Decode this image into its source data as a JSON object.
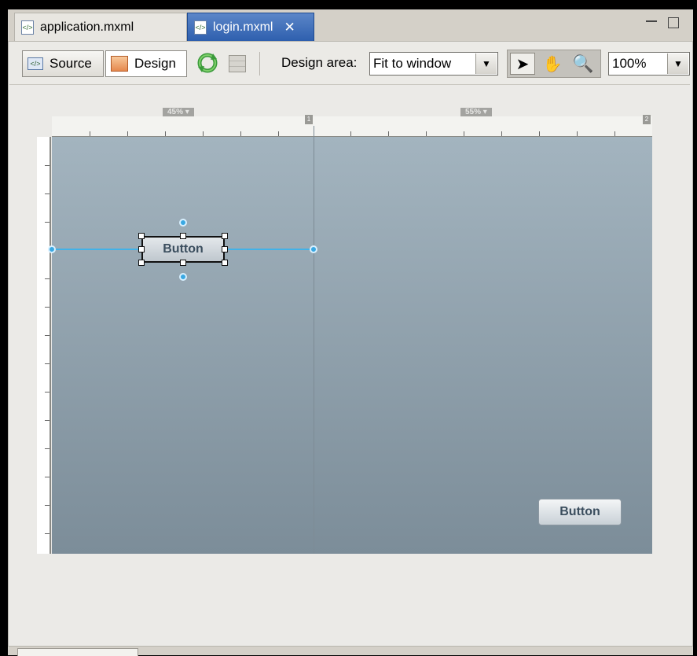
{
  "tabs": [
    {
      "label": "application.mxml",
      "active": false
    },
    {
      "label": "login.mxml",
      "active": true
    }
  ],
  "toolbar": {
    "source_label": "Source",
    "design_label": "Design",
    "design_area_label": "Design area:",
    "design_area_value": "Fit to window",
    "zoom_value": "100%"
  },
  "canvas": {
    "left_pct": "45%",
    "right_pct": "55%",
    "selected_button_label": "Button",
    "second_button_label": "Button"
  },
  "colors": {
    "active_tab": "#2e5fae",
    "stage_top": "#a3b4bf",
    "stage_bottom": "#7c8d99",
    "constraint_line": "#42b2e8"
  }
}
